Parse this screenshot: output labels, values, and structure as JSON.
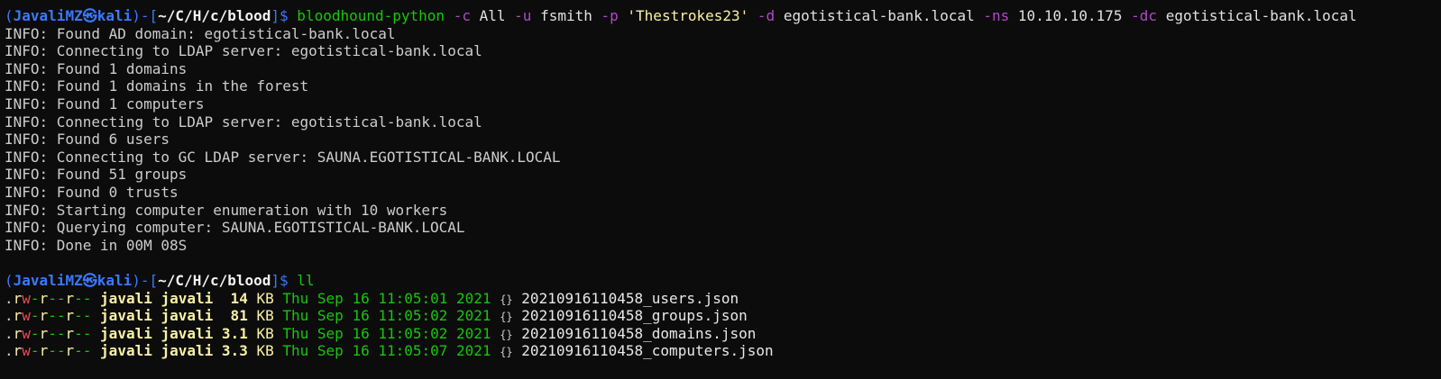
{
  "prompt": {
    "user": "JavaliMZ",
    "skull": "㉿",
    "host": "kali",
    "cwd": "~/C/H/c/blood"
  },
  "command1": {
    "program": "bloodhound-python",
    "parts": [
      {
        "flag": "-c",
        "value": "All",
        "kind": "arg"
      },
      {
        "flag": "-u",
        "value": "fsmith",
        "kind": "arg"
      },
      {
        "flag": "-p",
        "value": "'Thestrokes23'",
        "kind": "str"
      },
      {
        "flag": "-d",
        "value": "egotistical-bank.local",
        "kind": "arg"
      },
      {
        "flag": "-ns",
        "value": "10.10.10.175",
        "kind": "arg"
      },
      {
        "flag": "-dc",
        "value": "egotistical-bank.local",
        "kind": "arg"
      }
    ]
  },
  "output": [
    "INFO: Found AD domain: egotistical-bank.local",
    "INFO: Connecting to LDAP server: egotistical-bank.local",
    "INFO: Found 1 domains",
    "INFO: Found 1 domains in the forest",
    "INFO: Found 1 computers",
    "INFO: Connecting to LDAP server: egotistical-bank.local",
    "INFO: Found 6 users",
    "INFO: Connecting to GC LDAP server: SAUNA.EGOTISTICAL-BANK.LOCAL",
    "INFO: Found 51 groups",
    "INFO: Found 0 trusts",
    "INFO: Starting computer enumeration with 10 workers",
    "INFO: Querying computer: SAUNA.EGOTISTICAL-BANK.LOCAL",
    "INFO: Done in 00M 08S"
  ],
  "command2": {
    "program": "ll"
  },
  "files": [
    {
      "perms": ".rw-r--r--",
      "user": "javali",
      "group": "javali",
      "size": " 14",
      "unit": "KB",
      "date": "Thu Sep 16 11:05:01 2021",
      "icon": "{}",
      "name": "20210916110458_users.json"
    },
    {
      "perms": ".rw-r--r--",
      "user": "javali",
      "group": "javali",
      "size": " 81",
      "unit": "KB",
      "date": "Thu Sep 16 11:05:02 2021",
      "icon": "{}",
      "name": "20210916110458_groups.json"
    },
    {
      "perms": ".rw-r--r--",
      "user": "javali",
      "group": "javali",
      "size": "3.1",
      "unit": "KB",
      "date": "Thu Sep 16 11:05:02 2021",
      "icon": "{}",
      "name": "20210916110458_domains.json"
    },
    {
      "perms": ".rw-r--r--",
      "user": "javali",
      "group": "javali",
      "size": "3.3",
      "unit": "KB",
      "date": "Thu Sep 16 11:05:07 2021",
      "icon": "{}",
      "name": "20210916110458_computers.json"
    }
  ],
  "colors": {
    "background": "#0c0c0c",
    "prompt": "#3b78ff",
    "command": "#16c60c",
    "flag": "#b148c6",
    "string": "#f9f1a5"
  }
}
